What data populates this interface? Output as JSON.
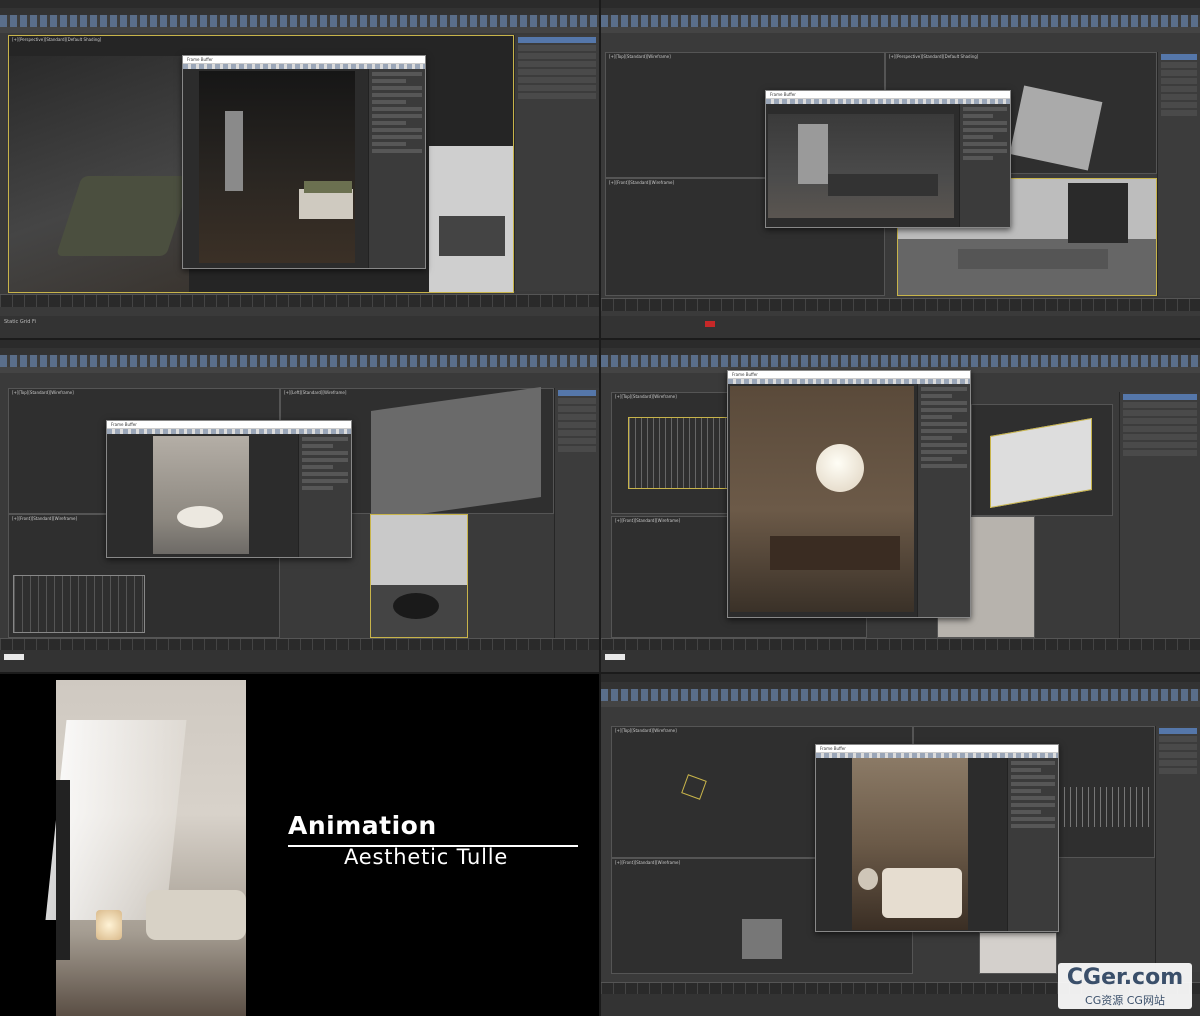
{
  "panels": {
    "p1": {
      "status": "Static Grid Fi",
      "viewport_labels": [
        "[+][Perspective][Standard][Default Shading]"
      ],
      "fb_title": "Frame Buffer"
    },
    "p2": {
      "viewport_labels": [
        "[+][Top][Standard][Wireframe]",
        "[+][Front][Standard][Wireframe]",
        "[+][Perspective][Standard][Default Shading]"
      ],
      "fb_title": "Frame Buffer"
    },
    "p3": {
      "viewport_labels": [
        "[+][Top][Standard][Wireframe]",
        "[+][Front][Standard][Wireframe]",
        "[+][Left][Standard][Wireframe]"
      ],
      "fb_title": "Frame Buffer"
    },
    "p4": {
      "viewport_labels": [
        "[+][Top][Standard][Wireframe]",
        "[+][Front][Standard][Wireframe]"
      ],
      "fb_title": "Frame Buffer"
    },
    "p6": {
      "viewport_labels": [
        "[+][Top][Standard][Wireframe]",
        "[+][Front][Standard][Wireframe]"
      ],
      "fb_title": "Frame Buffer"
    }
  },
  "promo": {
    "title": "Animation",
    "subtitle": "Aesthetic Tulle"
  },
  "watermark": {
    "main": "CGer.com",
    "sub": "CG资源 CG网站"
  },
  "colors": {
    "ui_bg": "#3a3a3a",
    "toolbar_icon": "#5a6e8a",
    "active_viewport": "#c8b44a",
    "promo_bg": "#000000",
    "watermark_text": "#3a4f6a"
  }
}
